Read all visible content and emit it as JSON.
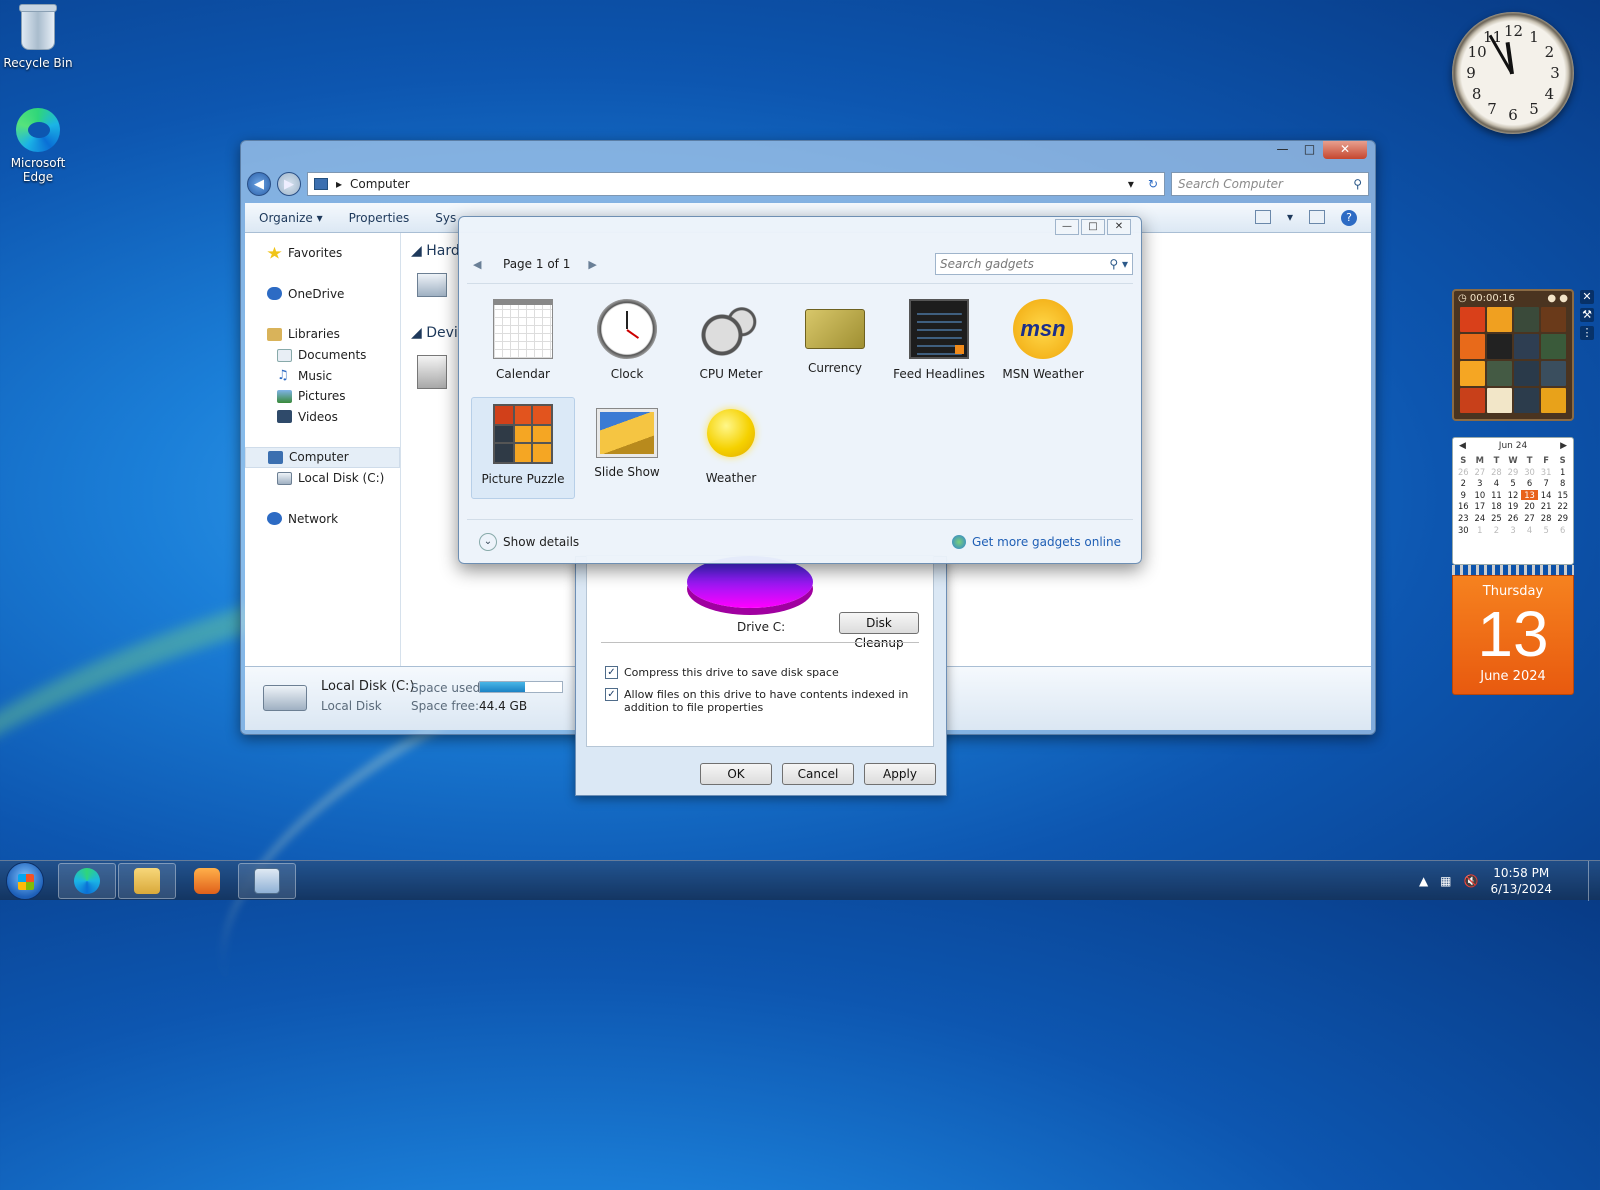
{
  "desktop": {
    "icons": [
      {
        "label": "Recycle Bin"
      },
      {
        "label": "Microsoft Edge"
      }
    ]
  },
  "explorer": {
    "address": "Computer",
    "search_placeholder": "Search Computer",
    "toolbar": {
      "organize": "Organize",
      "properties": "Properties",
      "system_properties": "Sys"
    },
    "nav": {
      "favorites": "Favorites",
      "onedrive": "OneDrive",
      "libraries": "Libraries",
      "documents": "Documents",
      "music": "Music",
      "pictures": "Pictures",
      "videos": "Videos",
      "computer": "Computer",
      "local_disk": "Local Disk (C:)",
      "network": "Network"
    },
    "sections": {
      "hard_disks": "Hard",
      "devices": "Devi"
    },
    "details": {
      "name": "Local Disk (C:)",
      "type": "Local Disk",
      "space_used_label": "Space used:",
      "space_free_label": "Space free:",
      "space_free_value": "44.4 GB",
      "space_used_fraction": 0.55
    }
  },
  "gadget_gallery": {
    "page": "Page 1 of 1",
    "search_placeholder": "Search gadgets",
    "gadgets": [
      {
        "name": "Calendar",
        "icon": "calendar-icon"
      },
      {
        "name": "Clock",
        "icon": "clock-icon"
      },
      {
        "name": "CPU Meter",
        "icon": "cpu-meter-icon"
      },
      {
        "name": "Currency",
        "icon": "currency-icon"
      },
      {
        "name": "Feed Headlines",
        "icon": "feed-headlines-icon"
      },
      {
        "name": "MSN Weather",
        "icon": "msn-weather-icon",
        "text": "msn"
      },
      {
        "name": "Picture Puzzle",
        "icon": "picture-puzzle-icon",
        "selected": true
      },
      {
        "name": "Slide Show",
        "icon": "slide-show-icon"
      },
      {
        "name": "Weather",
        "icon": "weather-icon"
      }
    ],
    "show_details": "Show details",
    "get_more": "Get more gadgets online"
  },
  "drive_properties": {
    "drive_label": "Drive C:",
    "disk_cleanup": "Disk Cleanup",
    "compress_label": "Compress this drive to save disk space",
    "compress_checked": true,
    "index_label": "Allow files on this drive to have contents indexed in addition to file properties",
    "index_checked": true,
    "ok": "OK",
    "cancel": "Cancel",
    "apply": "Apply",
    "pie_colors": {
      "used": "#2d32e8",
      "free": "#ff00ff"
    }
  },
  "desktop_gadgets": {
    "clock": {
      "numbers": [
        "12",
        "1",
        "2",
        "3",
        "4",
        "5",
        "6",
        "7",
        "8",
        "9",
        "10",
        "11"
      ]
    },
    "puzzle": {
      "timer": "00:00:16"
    },
    "calendar": {
      "month_title": "Jun 24",
      "day_headers": [
        "S",
        "M",
        "T",
        "W",
        "T",
        "F",
        "S"
      ],
      "days": [
        "26",
        "27",
        "28",
        "29",
        "30",
        "31",
        "1",
        "2",
        "3",
        "4",
        "5",
        "6",
        "7",
        "8",
        "9",
        "10",
        "11",
        "12",
        "13",
        "14",
        "15",
        "16",
        "17",
        "18",
        "19",
        "20",
        "21",
        "22",
        "23",
        "24",
        "25",
        "26",
        "27",
        "28",
        "29",
        "30",
        "1",
        "2",
        "3",
        "4",
        "5",
        "6"
      ],
      "today": "13",
      "weekday": "Thursday",
      "day_number": "13",
      "month_year": "June 2024"
    }
  },
  "taskbar": {
    "time": "10:58 PM",
    "date": "6/13/2024"
  },
  "colors": {
    "accent": "#1f5fb5",
    "calendar_orange": "#e85a0f"
  }
}
